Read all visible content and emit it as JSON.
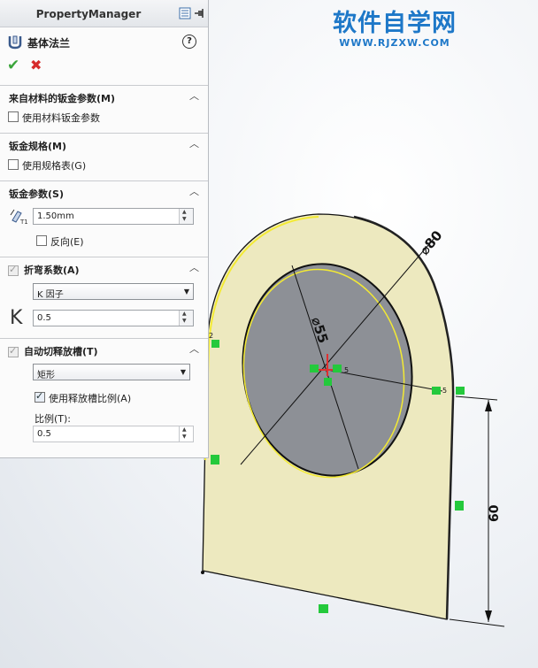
{
  "panel": {
    "title": "PropertyManager",
    "feature_name": "基体法兰",
    "help": "?",
    "ok": "✔",
    "cancel": "✖"
  },
  "groups": {
    "material": {
      "title": "来自材料的钣金参数(M)",
      "checkbox_label": "使用材料钣金参数",
      "checked": false
    },
    "gauge": {
      "title": "钣金规格(M)",
      "checkbox_label": "使用规格表(G)",
      "checked": false
    },
    "params": {
      "title": "钣金参数(S)",
      "thickness": "1.50mm",
      "reverse_label": "反向(E)",
      "reverse_checked": false
    },
    "bend": {
      "title": "折弯系数(A)",
      "type": "K 因子",
      "k_label": "K",
      "k_value": "0.5",
      "checked": true
    },
    "relief": {
      "title": "自动切释放槽(T)",
      "type": "矩形",
      "ratio_checkbox": "使用释放槽比例(A)",
      "ratio_checked": true,
      "ratio_label": "比例(T):",
      "ratio_value": "0.5"
    }
  },
  "watermark": {
    "title": "软件自学网",
    "url": "WWW.RJZXW.COM"
  },
  "sketch": {
    "diameter_outer": "⌀80",
    "diameter_inner": "⌀55",
    "height": "60",
    "label_2": "2",
    "label_5a": "5",
    "label_5b": "5"
  },
  "colors": {
    "sheet_fill": "#ede9bf",
    "hole_fill": "#8d9096",
    "edge_highlight": "#f3ea33",
    "relation_green": "#24c93c",
    "origin_red": "#e03030"
  }
}
